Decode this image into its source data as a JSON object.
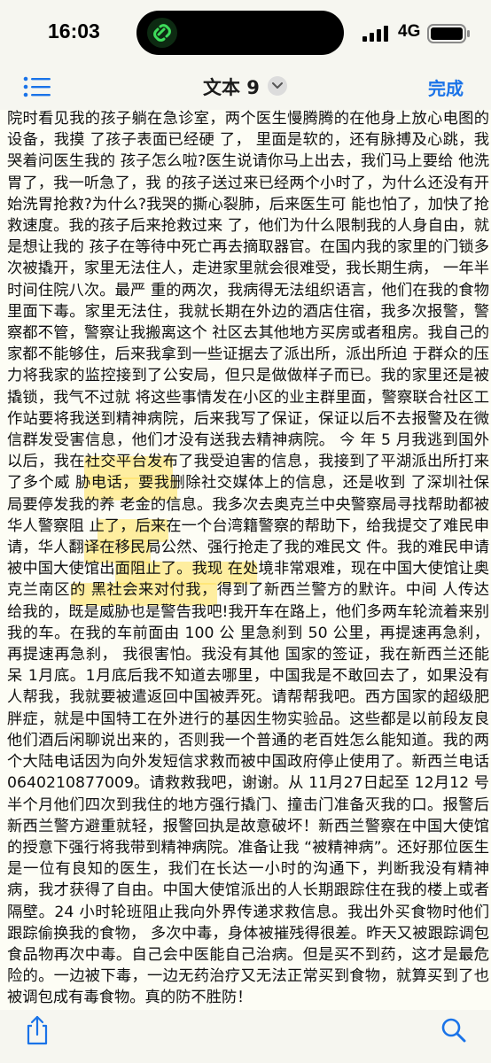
{
  "status_bar": {
    "time": "16:03",
    "network": "4G"
  },
  "toolbar": {
    "title": "文本 9",
    "done_label": "完成"
  },
  "document": {
    "text": "院时看见我的孩子躺在急诊室，两个医生慢腾腾的在他身上放心电图的设备，我摸 了孩子表面已经硬 了， 里面是软的，还有脉搏及心跳，我哭着问医生我的 孩子怎么啦?医生说请你马上出去，我们马上要给 他洗胃了，我一听急了，我 的孩子送过来已经两个小时了，为什么还没有开始洗胃抢救?为什么?我哭的撕心裂肺，后来医生可 能也怕了，加快了抢救速度。我的孩子后来抢救过来 了，他们为什么限制我的人身自由，就是想让我的 孩子在等待中死亡再去摘取器官。在国内我的家里的门锁多次被撬开，家里无法住人，走进家里就会很难受，我长期生病， 一年半时间住院八次。最严 重的两次，我病得无法组织语言，他们在我的食物 里面下毒。家里无法住，我就长期在外边的酒店住宿，我多次报警，警察都不管，警察让我搬离这个 社区去其他地方买房或者租房。我自己的家都不能够住，后来我拿到一些证据去了派出所，派出所迫 于群众的压力将我家的监控接到了公安局，但只是做做样子而已。我的家里还是被撬锁，我气不过就 将这些事情发在小区的业主群里面，警察联合社区工作站要将我送到精神病院，后来我写了保证，保证以后不去报警及在微信群发受害信息，他们才没有送我去精神病院。 今 年 5 月我逃到国外以后，我在社交平台发布了我受迫害的信息，我接到了平湖派出所打来了多个威 胁电话，要我删除社交媒体上的信息，还是收到 了深圳社保局要停发我的养 老金的信息。我多次去奥克兰中央警察局寻找帮助都被华人警察阻 止了，后来在一个台湾籍警察的帮助下，给我提交了难民申请，华人翻译在移民局公然、强行抢走了我的难民文 件。我的难民申请被中国大使馆出面阻止了。我现 在处境非常艰难，现在中国大使馆让奥克兰南区的 黑社会来对付我，得到了新西兰警方的默许。中间 人传达给我的，既是威胁也是警告我吧!我开车在路上，他们多两车轮流着来别我的车。在我的车前面由 100 公 里急刹到 50 公里，再提速再急刹，再提速再急刹， 我很害怕。我没有其他 国家的签证，我在新西兰还能呆 1月底。1月底后我不知道去哪里，中国我是不敢回去了，如果没有人帮我，我就要被遣返回中国被弄死。请帮帮我吧。西方国家的超级肥胖症，就是中国特工在外进行的基因生物实验品。这些都是以前段友良他们酒后闲聊说出来的，否则我一个普通的老百姓怎么能知道。我的两个大陆电话因为向外发短信求救而被中国政府停止使用了。新西兰电话 0640210877009。请救救我吧，谢谢。从 11月27日起至 12月12 号半个月他们四次到我住的地方强行撬门、撞击门准备灭我的口。报警后新西兰警方避重就轻，报警回执是故意破坏！新西兰警察在中国大使馆的授意下强行将我带到精神病院。准备让我 “被精神病”。还好那位医生是一位有良知的医生，我们在长达一小时的沟通下，判断我没有精神病，我才获得了自由。中国大使馆派出的人长期跟踪住在我的楼上或者隔壁。24 小时轮班阻止我向外界传递求救信息。我出外买食物时他们跟踪偷换我的食物， 多次中毒，身体被摧残得很差。昨天又被跟踪调包食品物再次中毒。自己会中医能自己治病。但是买不到药，这才是最危险的。一边被下毒，一边无药治疗又无法正常买到食物，就算买到了也被调包成有毒食物。真的防不胜防！"
  },
  "colors": {
    "accent": "#1a73e8",
    "highlight": "#ffe25a"
  },
  "icons": {
    "outline": "list-icon",
    "title_menu": "chevron-down-icon",
    "share": "share-icon",
    "search": "search-icon"
  }
}
